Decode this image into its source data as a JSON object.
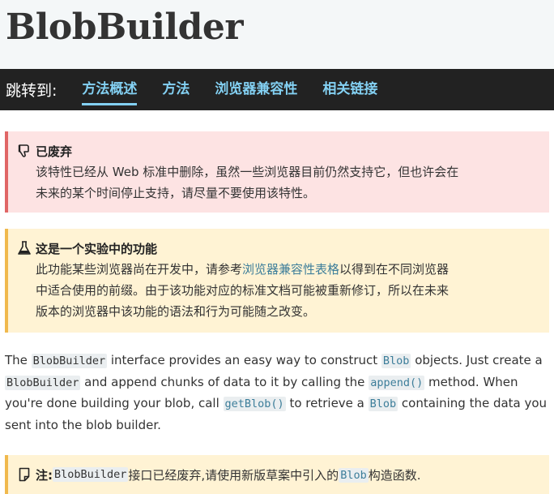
{
  "page": {
    "title": "BlobBuilder"
  },
  "jump_bar": {
    "label": "跳转到:",
    "links": [
      "方法概述",
      "方法",
      "浏览器兼容性",
      "相关链接"
    ]
  },
  "deprecated_notice": {
    "icon": "thumbs-down-icon",
    "heading": "已废弃",
    "line1": "该特性已经从 Web 标准中删除，虽然一些浏览器目前仍然支持它，但也许会在",
    "line2": "未来的某个时间停止支持，请尽量不要使用该特性。",
    "accent_color": "#e06666"
  },
  "experimental_notice": {
    "icon": "flask-icon",
    "heading": "这是一个实验中的功能",
    "line1_pre": "此功能某些浏览器尚在开发中，请参考",
    "line1_link": "浏览器兼容性表格",
    "line1_post": "以得到在不同浏览器",
    "line2": "中适合使用的前缀。由于该功能对应的标准文档可能被重新修订，所以在未来",
    "line3": "版本的浏览器中该功能的语法和行为可能随之改变。",
    "accent_color": "#f0b94d"
  },
  "intro": {
    "t1": "The ",
    "c1": "BlobBuilder",
    "t2": " interface provides an easy way to construct ",
    "c2": "Blob",
    "t3": " objects. Just create a ",
    "c3": "BlobBuilder",
    "t4": " and append chunks of data to it by calling the ",
    "c4": "append()",
    "t5": " method. When you're done building your blob, call ",
    "c5": "getBlob()",
    "t6": " to retrieve a ",
    "c6": "Blob",
    "t7": " containing the data you sent into the blob builder."
  },
  "note": {
    "icon": "note-icon",
    "label": "注:",
    "code1": "BlobBuilder",
    "text1": "接口已经废弃,请使用新版草案中引入的 ",
    "code2": "Blob",
    "text2": "构造函数."
  },
  "colors": {
    "link": "#3d7e9a",
    "jump_link": "#83d0f2",
    "jump_bar_bg": "#222222"
  }
}
